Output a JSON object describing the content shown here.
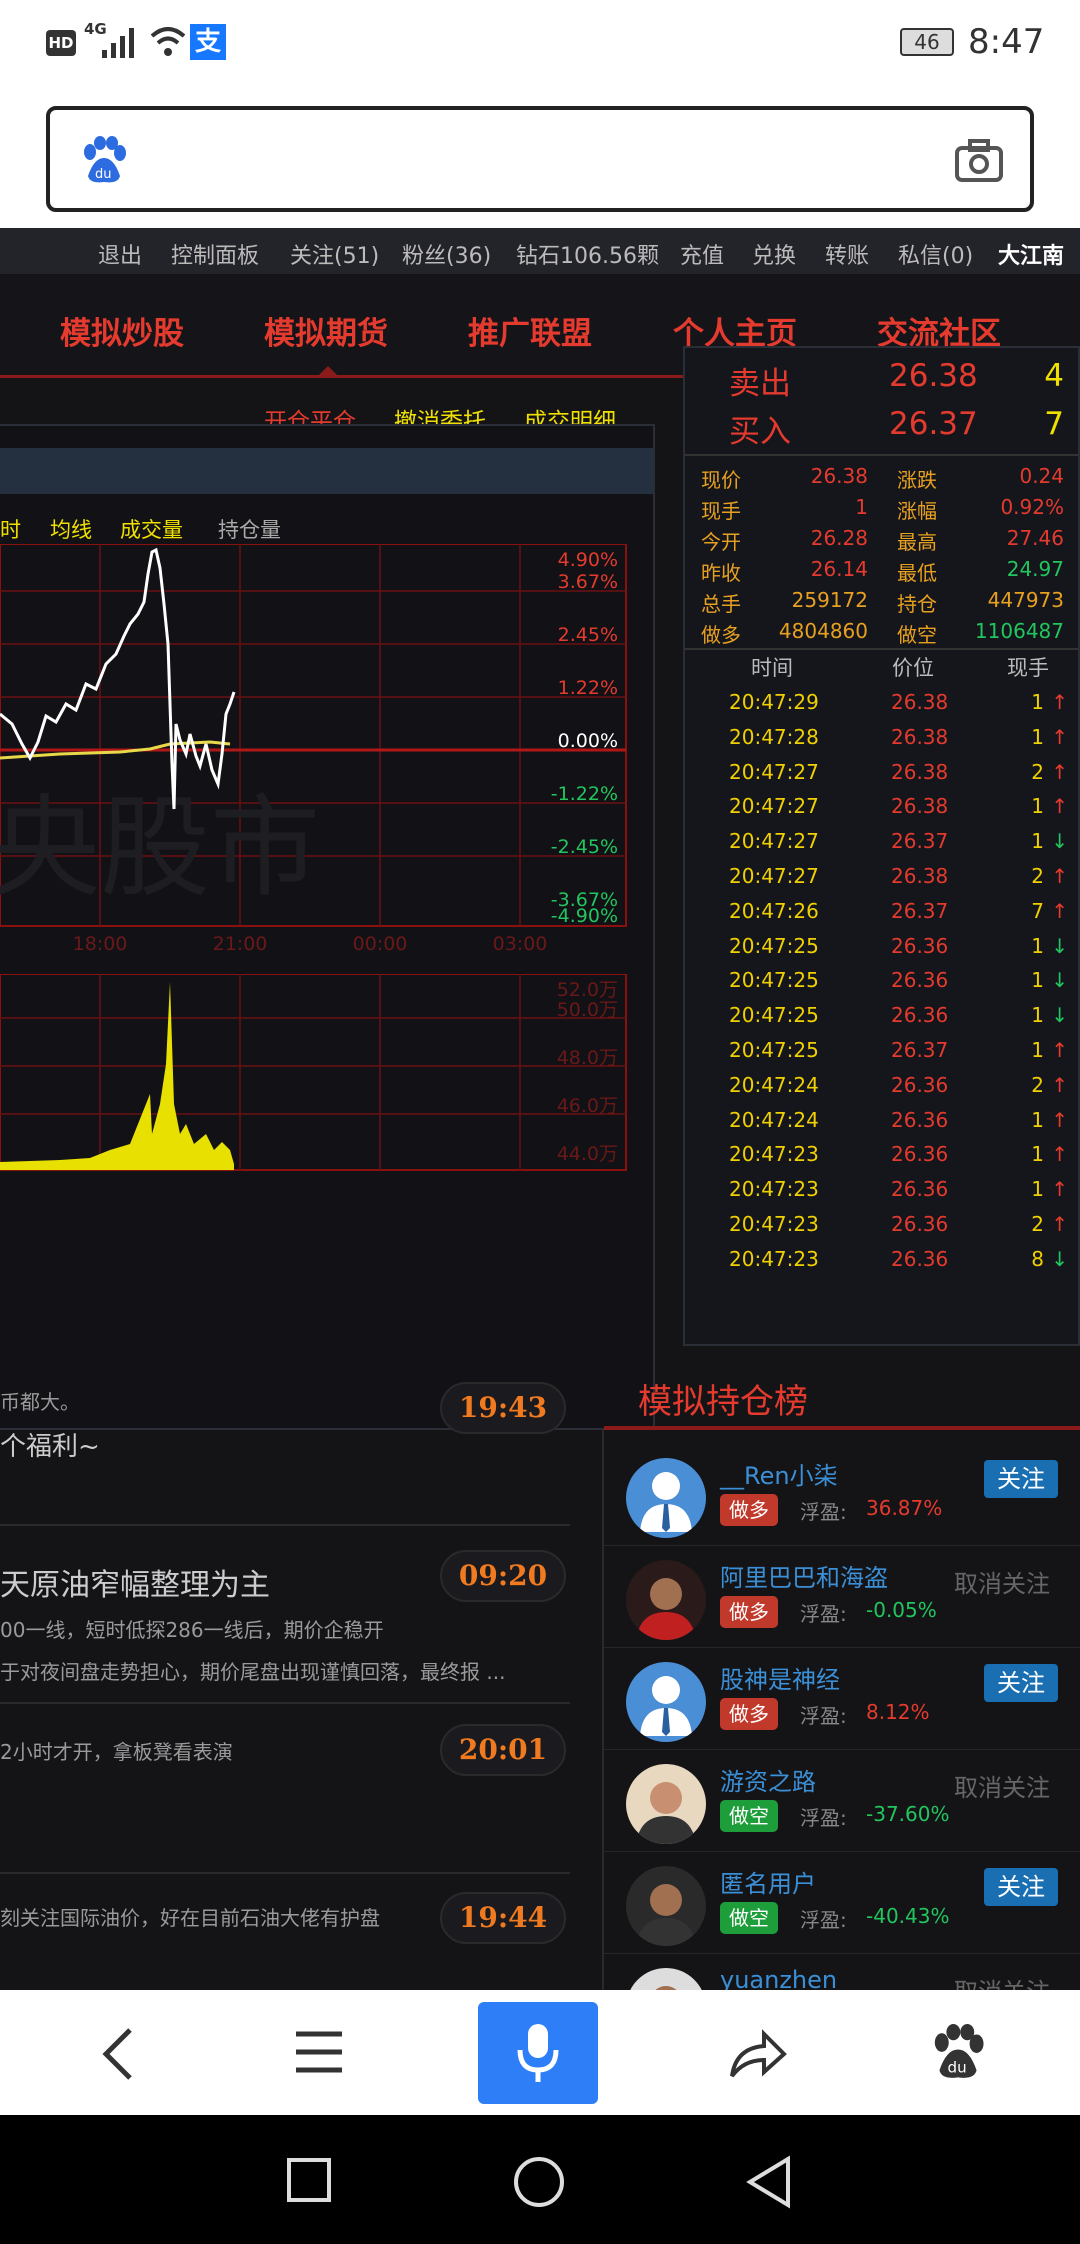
{
  "status_bar": {
    "left_icons": [
      "HD",
      "4G",
      "signal-icon",
      "wifi-icon",
      "alipay-icon"
    ],
    "battery": "46",
    "time": "8:47"
  },
  "search": {
    "logo": "baidu-paw-icon",
    "placeholder": "",
    "camera": "camera-icon"
  },
  "topbar": {
    "items": [
      "退出",
      "控制面板",
      "关注(51)",
      "粉丝(36)",
      "钻石106.56颗",
      "充值",
      "兑换",
      "转账",
      "私信(0)",
      "大江南"
    ]
  },
  "nav": {
    "items": [
      "模拟炒股",
      "模拟期货",
      "推广联盟",
      "个人主页",
      "交流社区"
    ],
    "active": 1
  },
  "chart": {
    "actions": [
      "开仓平仓",
      "撤消委托",
      "成交明细"
    ],
    "tabs": [
      "时",
      "均线",
      "成交量",
      "持仓量"
    ],
    "watermark": "央股市",
    "chart_data": {
      "type": "line",
      "price_ticks": [
        "4.90%",
        "3.67%",
        "2.45%",
        "1.22%",
        "0.00%",
        "-1.22%",
        "-2.45%",
        "-3.67%",
        "-4.90%"
      ],
      "time_ticks": [
        "18:00",
        "21:00",
        "00:00",
        "03:00"
      ],
      "volume_ticks": [
        "52.0万",
        "50.0万",
        "48.0万",
        "46.0万",
        "44.0万"
      ],
      "ylim": [
        -4.9,
        4.9
      ]
    }
  },
  "orderbook": {
    "sell": {
      "label": "卖出",
      "price": "26.38",
      "qty": "4"
    },
    "buy": {
      "label": "买入",
      "price": "26.37",
      "qty": "7"
    },
    "stats": [
      {
        "k1": "现价",
        "v1": "26.38",
        "k2": "涨跌",
        "v2": "0.24"
      },
      {
        "k1": "现手",
        "v1": "1",
        "k2": "涨幅",
        "v2": "0.92%"
      },
      {
        "k1": "今开",
        "v1": "26.28",
        "k2": "最高",
        "v2": "27.46"
      },
      {
        "k1": "昨收",
        "v1": "26.14",
        "k2": "最低",
        "v2": "24.97"
      },
      {
        "k1": "总手",
        "v1": "259172",
        "k2": "持仓",
        "v2": "447973"
      },
      {
        "k1": "做多",
        "v1": "4804860",
        "k2": "做空",
        "v2": "1106487"
      }
    ],
    "trade_header": [
      "时间",
      "价位",
      "现手"
    ],
    "trades": [
      {
        "t": "20:47:29",
        "p": "26.38",
        "q": "1",
        "d": "↑"
      },
      {
        "t": "20:47:28",
        "p": "26.38",
        "q": "1",
        "d": "↑"
      },
      {
        "t": "20:47:27",
        "p": "26.38",
        "q": "2",
        "d": "↑"
      },
      {
        "t": "20:47:27",
        "p": "26.38",
        "q": "1",
        "d": "↑"
      },
      {
        "t": "20:47:27",
        "p": "26.37",
        "q": "1",
        "d": "↓"
      },
      {
        "t": "20:47:27",
        "p": "26.38",
        "q": "2",
        "d": "↑"
      },
      {
        "t": "20:47:26",
        "p": "26.37",
        "q": "7",
        "d": "↑"
      },
      {
        "t": "20:47:25",
        "p": "26.36",
        "q": "1",
        "d": "↓"
      },
      {
        "t": "20:47:25",
        "p": "26.36",
        "q": "1",
        "d": "↓"
      },
      {
        "t": "20:47:25",
        "p": "26.36",
        "q": "1",
        "d": "↓"
      },
      {
        "t": "20:47:25",
        "p": "26.37",
        "q": "1",
        "d": "↑"
      },
      {
        "t": "20:47:24",
        "p": "26.36",
        "q": "2",
        "d": "↑"
      },
      {
        "t": "20:47:24",
        "p": "26.36",
        "q": "1",
        "d": "↑"
      },
      {
        "t": "20:47:23",
        "p": "26.36",
        "q": "1",
        "d": "↑"
      },
      {
        "t": "20:47:23",
        "p": "26.36",
        "q": "1",
        "d": "↑"
      },
      {
        "t": "20:47:23",
        "p": "26.36",
        "q": "2",
        "d": "↑"
      },
      {
        "t": "20:47:23",
        "p": "26.36",
        "q": "8",
        "d": "↓"
      }
    ]
  },
  "news": [
    {
      "line1": "币都大。",
      "line2": "个福利~",
      "time": "19:43"
    },
    {
      "title": "天原油窄幅整理为主",
      "line1": "00一线，短时低探286一线后，期价企稳开",
      "line2": "于对夜间盘走势担心，期价尾盘出现谨慎回落，最终报 ...",
      "time": "09:20"
    },
    {
      "line1": "2小时才开，拿板凳看表演",
      "time": "20:01"
    },
    {
      "line1": "刻关注国际油价，好在目前石油大佬有护盘",
      "time": "19:44"
    }
  ],
  "ranking": {
    "title": "模拟持仓榜",
    "items": [
      {
        "name": "__Ren小柒",
        "tag": "做多",
        "profit_label": "浮盈:",
        "profit": "36.87%",
        "action": "关注",
        "followed": false
      },
      {
        "name": "阿里巴巴和海盗",
        "tag": "做多",
        "profit_label": "浮盈:",
        "profit": "-0.05%",
        "action": "取消关注",
        "followed": true
      },
      {
        "name": "股神是神经",
        "tag": "做多",
        "profit_label": "浮盈:",
        "profit": "8.12%",
        "action": "关注",
        "followed": false
      },
      {
        "name": "游资之路",
        "tag": "做空",
        "profit_label": "浮盈:",
        "profit": "-37.60%",
        "action": "取消关注",
        "followed": true
      },
      {
        "name": "匿名用户",
        "tag": "做空",
        "profit_label": "浮盈:",
        "profit": "-40.43%",
        "action": "关注",
        "followed": false
      },
      {
        "name": "yuanzhen",
        "tag": "",
        "profit_label": "",
        "profit": "",
        "action": "取消关注",
        "followed": true
      }
    ]
  },
  "colors": {
    "red": "#e53a2e",
    "green": "#22c55e",
    "yellow": "#f0e000",
    "accent_blue": "#1a6fb3",
    "mic_blue": "#2d7ef7"
  },
  "bottom_bar": {
    "icons": [
      "back-icon",
      "menu-icon",
      "mic-icon",
      "share-icon",
      "baidu-paw-icon"
    ]
  }
}
